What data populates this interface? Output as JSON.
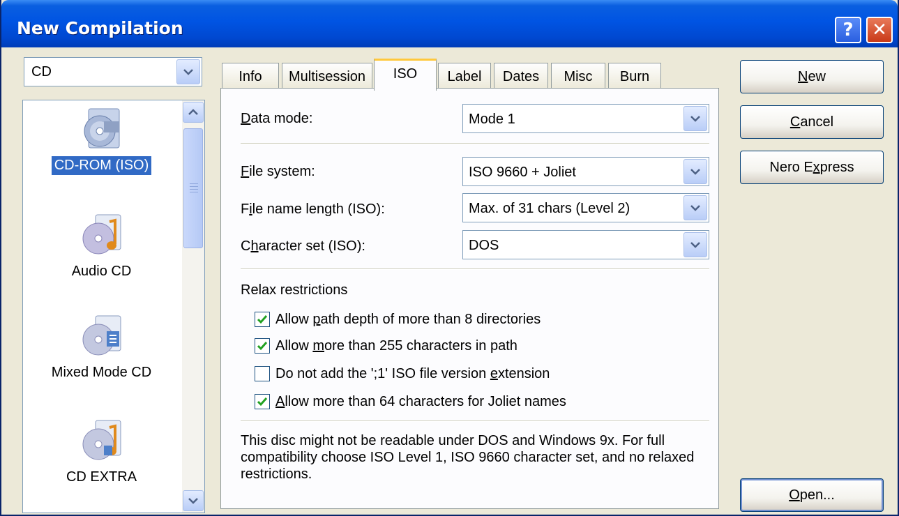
{
  "window": {
    "title": "New Compilation"
  },
  "title_buttons": {
    "help": "?",
    "close": "✕"
  },
  "disc_type": {
    "value": "CD"
  },
  "compilation_types": [
    {
      "label": "CD-ROM (ISO)",
      "icon": "cd-rom-iso-icon",
      "selected": true
    },
    {
      "label": "Audio CD",
      "icon": "audio-cd-icon",
      "selected": false
    },
    {
      "label": "Mixed Mode CD",
      "icon": "mixed-mode-cd-icon",
      "selected": false
    },
    {
      "label": "CD EXTRA",
      "icon": "cd-extra-icon",
      "selected": false
    }
  ],
  "tabs": [
    {
      "label": "Info",
      "active": false
    },
    {
      "label": "Multisession",
      "active": false
    },
    {
      "label": "ISO",
      "active": true
    },
    {
      "label": "Label",
      "active": false
    },
    {
      "label": "Dates",
      "active": false
    },
    {
      "label": "Misc",
      "active": false
    },
    {
      "label": "Burn",
      "active": false
    }
  ],
  "iso": {
    "data_mode": {
      "label_access": "D",
      "label_rest": "ata mode:",
      "value": "Mode 1"
    },
    "file_system": {
      "label_access": "F",
      "label_rest": "ile system:",
      "value": "ISO 9660 + Joliet"
    },
    "file_name_length": {
      "label_pre": "F",
      "label_access": "i",
      "label_rest": "le name length (ISO):",
      "value": "Max. of 31 chars (Level 2)"
    },
    "character_set": {
      "label_pre": "C",
      "label_access": "h",
      "label_rest": "aracter set (ISO):",
      "value": "DOS"
    },
    "relax_title": "Relax restrictions",
    "options": [
      {
        "pre": "Allow ",
        "access": "p",
        "post": "ath depth of more than 8 directories",
        "checked": true
      },
      {
        "pre": "Allow ",
        "access": "m",
        "post": "ore than 255 characters in path",
        "checked": true
      },
      {
        "pre": "Do not add the ';1' ISO file version ",
        "access": "e",
        "post": "xtension",
        "checked": false
      },
      {
        "pre": "",
        "access": "A",
        "post": "llow more than 64 characters for Joliet names",
        "checked": true
      }
    ],
    "note": "This disc might not be readable under DOS and Windows 9x. For full compatibility choose ISO Level 1, ISO 9660 character set, and no relaxed restrictions."
  },
  "buttons": {
    "new": {
      "access": "N",
      "rest": "ew"
    },
    "cancel": {
      "access": "C",
      "rest": "ancel"
    },
    "nero_express": {
      "pre": "Nero E",
      "access": "x",
      "rest": "press"
    },
    "open": {
      "access": "O",
      "rest": "pen..."
    }
  },
  "colors": {
    "titlebar": "#0054e3",
    "selection": "#316ac5",
    "active_tab_accent": "#ffc83c",
    "checkmark": "#21a121"
  }
}
